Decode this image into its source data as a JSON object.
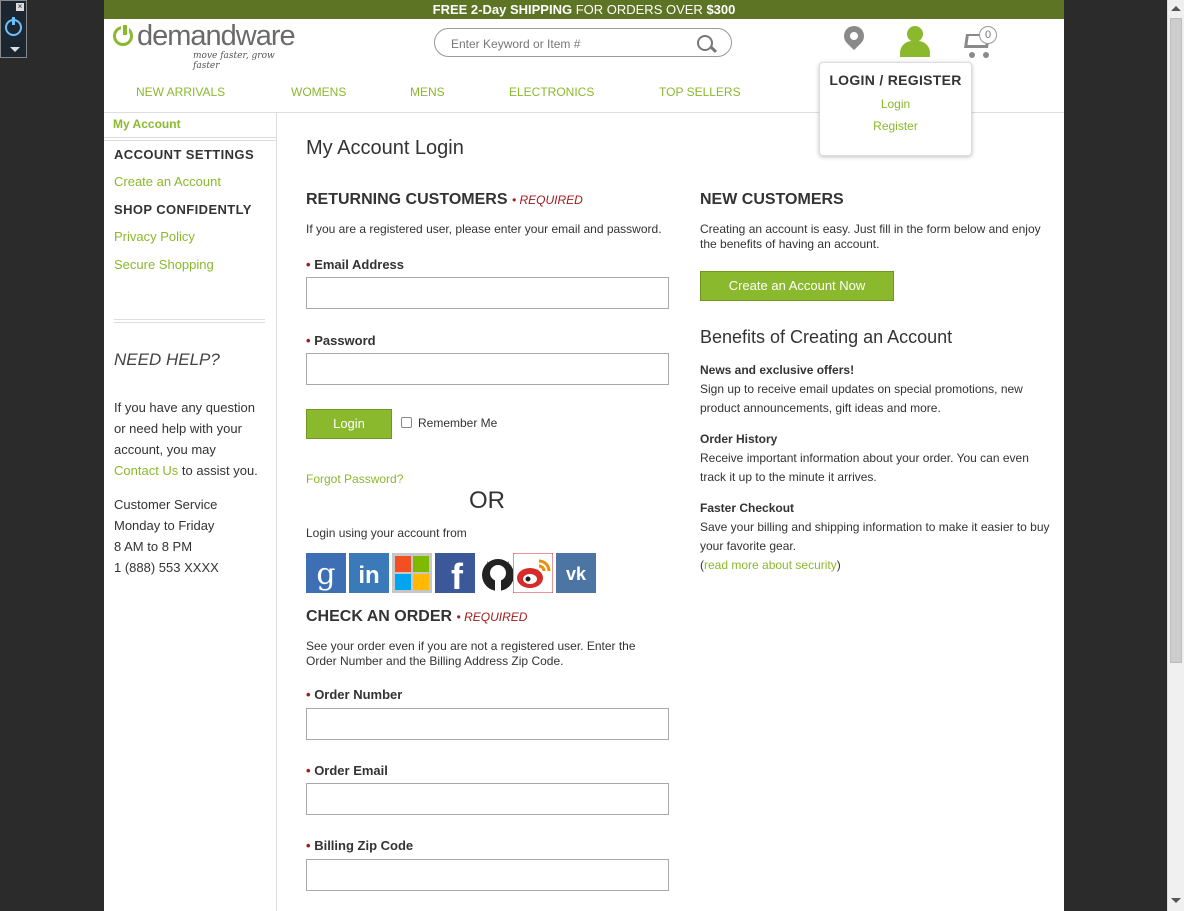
{
  "banner": {
    "bold1": "FREE 2-Day",
    "bold2": "SHIPPING",
    "rest": " FOR ORDERS OVER ",
    "amount": "$300"
  },
  "logo": {
    "name": "demandware",
    "tagline": "move faster, grow faster"
  },
  "search": {
    "placeholder": "Enter Keyword or Item #"
  },
  "header": {
    "cart_count": "0"
  },
  "account_dropdown": {
    "title": "LOGIN / REGISTER",
    "login": "Login",
    "register": "Register"
  },
  "nav": [
    "NEW ARRIVALS",
    "WOMENS",
    "MENS",
    "ELECTRONICS",
    "TOP SELLERS"
  ],
  "sidebar": {
    "breadcrumb": "My Account",
    "account_settings": "ACCOUNT SETTINGS",
    "create_account": "Create an Account",
    "shop_confidently": "SHOP CONFIDENTLY",
    "privacy_policy": "Privacy Policy",
    "secure_shopping": "Secure Shopping",
    "need_help": "NEED HELP?",
    "help_line1": "If you have any question",
    "help_line2": "or need help with your",
    "help_line3": "account, you may",
    "contact_us": "Contact Us",
    "help_tail": " to assist you.",
    "cs_title": "Customer Service",
    "cs_days": "Monday to Friday",
    "cs_hours": "8 AM to 8 PM",
    "cs_phone": "1 (888) 553 XXXX"
  },
  "main": {
    "page_title": "My Account Login",
    "returning": {
      "heading": "RETURNING CUSTOMERS",
      "required": "REQUIRED",
      "intro": "If you are a registered user, please enter your email and password.",
      "email_label": "Email Address",
      "password_label": "Password",
      "login_button": "Login",
      "remember_me": "Remember Me",
      "forgot_password": "Forgot Password?"
    },
    "or": "OR",
    "social_intro": "Login using your account from",
    "check_order": {
      "heading": "CHECK AN ORDER",
      "required": "REQUIRED",
      "intro_line1": "See your order even if you are not a registered user. Enter the",
      "intro_line2": "Order Number and the Billing Address Zip Code.",
      "order_number_label": "Order Number",
      "order_email_label": "Order Email",
      "zip_label": "Billing Zip Code"
    },
    "new_customers": {
      "heading": "NEW CUSTOMERS",
      "intro_line1": "Creating an account is easy. Just fill in the form below and enjoy",
      "intro_line2": "the benefits of having an account.",
      "create_button": "Create an Account Now",
      "benefits_title": "Benefits of Creating an Account",
      "b1_title": "News and exclusive offers!",
      "b1_line1": "Sign up to receive email updates on special promotions, new",
      "b1_line2": "product announcements, gift ideas and more.",
      "b2_title": "Order History",
      "b2_line1": "Receive important information about your order. You can even",
      "b2_line2": "track it up to the minute it arrives.",
      "b3_title": "Faster Checkout",
      "b3_line1": "Save your billing and shipping information to make it easier to buy",
      "b3_line2": "your favorite gear.",
      "security_link": "read more about security"
    }
  },
  "social_icons": [
    "google-icon",
    "linkedin-icon",
    "microsoft-icon",
    "facebook-icon",
    "github-icon",
    "weibo-icon",
    "vk-icon"
  ],
  "social_glyphs": {
    "google": "g",
    "linkedin": "in",
    "facebook": "f",
    "vk": "vk"
  },
  "colors": {
    "accent": "#8ab92d",
    "banner": "#5d7425",
    "required": "#a01c1c",
    "text": "#333333"
  }
}
